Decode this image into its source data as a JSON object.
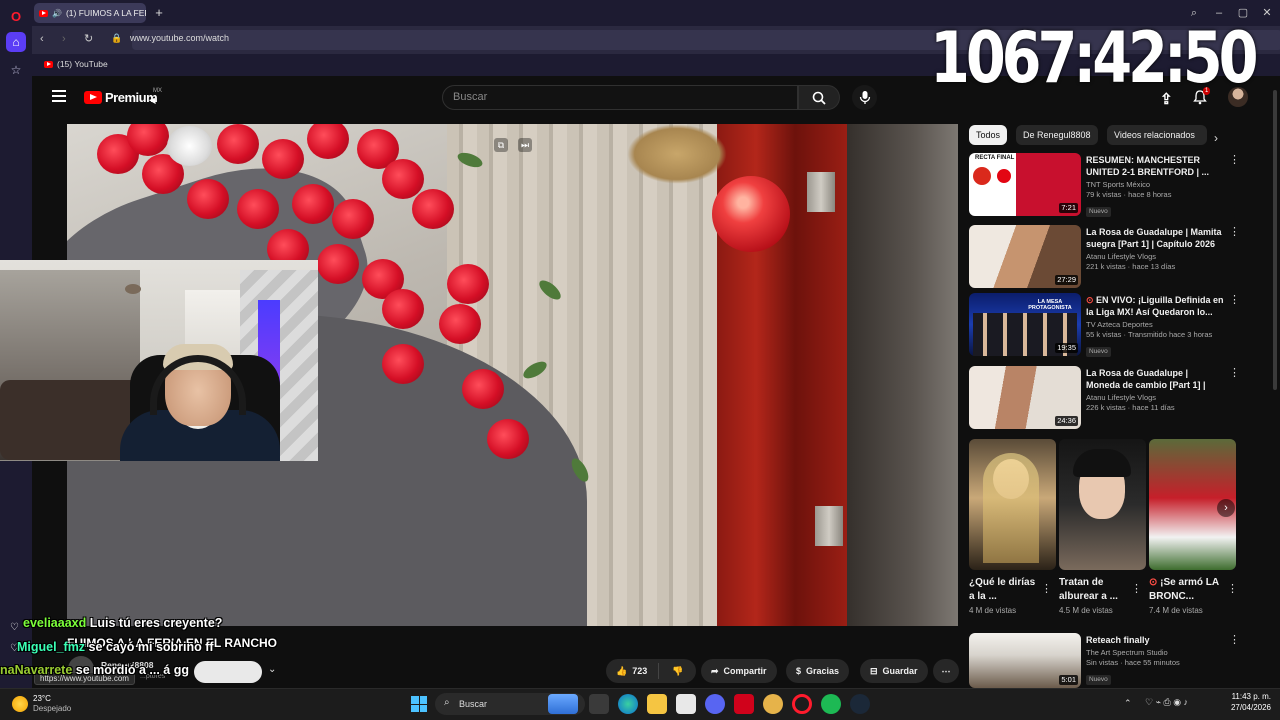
{
  "browser": {
    "tab_title": "(1) FUIMOS A LA FERI",
    "url": "www.youtube.com/watch",
    "bookmark_label": "(15) YouTube",
    "overlay_clock": "1067:42:50"
  },
  "youtube": {
    "logo_text": "Premium",
    "logo_region": "MX",
    "search_placeholder": "Buscar",
    "notification_count": "1"
  },
  "chips": [
    "Todos",
    "De Renegul8808",
    "Videos relacionados"
  ],
  "videos": [
    {
      "title": "RESUMEN: MANCHESTER UNITED 2-1 BRENTFORD | ...",
      "channel": "TNT Sports México",
      "stats": "79 k vistas · hace 8 horas",
      "duration": "7:21",
      "badge": "Nuevo",
      "thumb_caption": "RECTA FINAL"
    },
    {
      "title": "La Rosa de Guadalupe | Mamita suegra [Part 1] | Capítulo 2026",
      "channel": "Atanu Lifestyle Vlogs",
      "stats": "221 k vistas · hace 13 días",
      "duration": "27:29",
      "badge": "",
      "thumb_caption": ""
    },
    {
      "title": "EN VIVO: ¡Liguilla Definida en la Liga MX! Así Quedaron lo...",
      "channel": "TV Azteca Deportes",
      "stats": "55 k vistas · Transmitido hace 3 horas",
      "duration": "19:35",
      "badge": "Nuevo",
      "thumb_caption": "LA MESA PROTAGONISTA"
    },
    {
      "title": "La Rosa de Guadalupe | Moneda de cambio [Part 1] | Capítulo ...",
      "channel": "Atanu Lifestyle Vlogs",
      "stats": "226 k vistas · hace 11 días",
      "duration": "24:36",
      "badge": "",
      "thumb_caption": ""
    }
  ],
  "shorts": [
    {
      "title": "¿Qué le dirías a la ...",
      "views": "4 M de vistas"
    },
    {
      "title": "Tratan de alburear a ...",
      "views": "4.5 M de vistas"
    },
    {
      "title": "¡Se armó LA BRONC...",
      "views": "7.4 M de vistas"
    }
  ],
  "video_5": {
    "title": "Reteach finally",
    "channel": "The Art Spectrum Studio",
    "stats": "Sin vistas · hace 55 minutos",
    "duration": "5:01",
    "badge": "Nuevo"
  },
  "actions": {
    "likes": "723",
    "share": "Compartir",
    "thanks": "Gracias",
    "save": "Guardar"
  },
  "video_title_overlay": "FUIMOS A LA FERIA EN EL RANCHO",
  "channel_name": "Renegul8808",
  "channel_subs": "...ptores",
  "link_tooltip": "https://www.youtube.com",
  "chat": [
    {
      "user": "eveliaaaxd",
      "message": "Luis tú eres creyente?",
      "user_color": "#7cff3a"
    },
    {
      "user": "Miguel_fmz",
      "message": "se cayó mi sobrino ff",
      "user_color": "#3affb5"
    },
    {
      "user": "naNavarrete",
      "message": "se mordió a ... á gg",
      "user_color": "#9acd32"
    }
  ],
  "taskbar": {
    "temp": "23°C",
    "weather": "Despejado",
    "search": "Buscar",
    "time": "11:43 p. m.",
    "date": "27/04/2026"
  }
}
